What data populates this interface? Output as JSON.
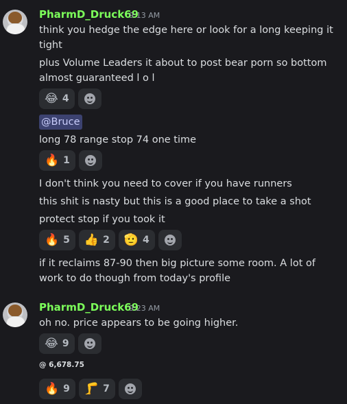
{
  "messages": [
    {
      "username": "PharmD_Druck69",
      "timestamp": "9:13 AM",
      "lines": [
        "think you hedge the edge here or look for a long keeping it",
        "tight",
        "plus Volume Leaders it about to post bear porn so bottom",
        "almost guaranteed l o l"
      ],
      "reactions_1": [
        {
          "emoji": "😂",
          "count": "4"
        }
      ],
      "mention": "@Bruce",
      "line_2": "long 78 range  stop 74 one time",
      "reactions_2": [
        {
          "emoji": "🔥",
          "count": "1"
        }
      ],
      "lines_3": [
        "I don't think you need to cover if you have runners",
        "this shit is nasty but this is a good place to take a shot",
        "protect stop if you took it"
      ],
      "reactions_3": [
        {
          "emoji": "🔥",
          "count": "5"
        },
        {
          "emoji": "👍",
          "count": "2"
        },
        {
          "emoji": "🫡",
          "count": "4"
        }
      ],
      "lines_4": [
        "if it reclaims 87-90 then big picture some room. A lot of",
        "work to do though from today's profile"
      ]
    },
    {
      "username": "PharmD_Druck69",
      "timestamp": "9:23 AM",
      "line": "oh no. price appears to be going higher.",
      "reactions_1": [
        {
          "emoji": "😂",
          "count": "9"
        }
      ],
      "price_note": "@ 6,678.75",
      "reactions_2": [
        {
          "emoji": "🔥",
          "count": "9"
        },
        {
          "emoji": "🦵",
          "count": "7"
        }
      ]
    }
  ],
  "colors": {
    "username": "#7cff5a",
    "background": "#1a1a1e",
    "reaction_bg": "#2b2d31",
    "mention_bg": "#3c4270"
  }
}
